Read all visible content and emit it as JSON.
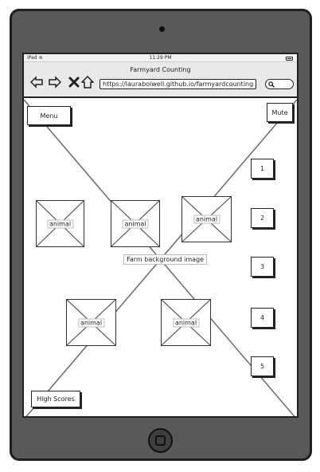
{
  "status": {
    "carrier": "iPad",
    "time": "11:29 PM"
  },
  "browser": {
    "title": "Farmyard Counting",
    "url": "https://laurabolwell.github.io/farmyardcounting"
  },
  "app": {
    "menu_label": "Menu",
    "mute_label": "Mute",
    "high_scores_label": "High Scores",
    "background_label": "Farm background image",
    "animal_label": "animal",
    "answers": [
      "1",
      "2",
      "3",
      "4",
      "5"
    ]
  }
}
